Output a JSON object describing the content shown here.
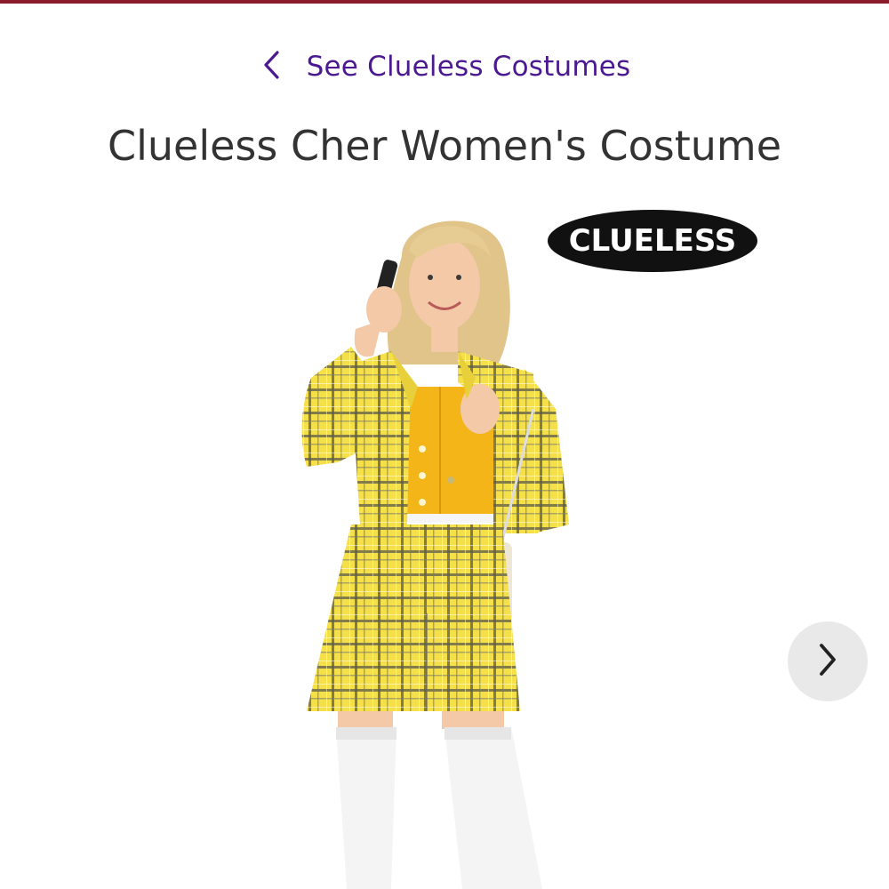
{
  "header": {
    "accent_color": "#8b1a2b"
  },
  "back_link": {
    "label": "See Clueless Costumes",
    "icon": "chevron-left-icon",
    "color": "#4b1a91"
  },
  "product": {
    "title": "Clueless Cher Women's Costume"
  },
  "gallery": {
    "brand_logo_text": "Clueless",
    "next_icon": "chevron-right-icon"
  }
}
